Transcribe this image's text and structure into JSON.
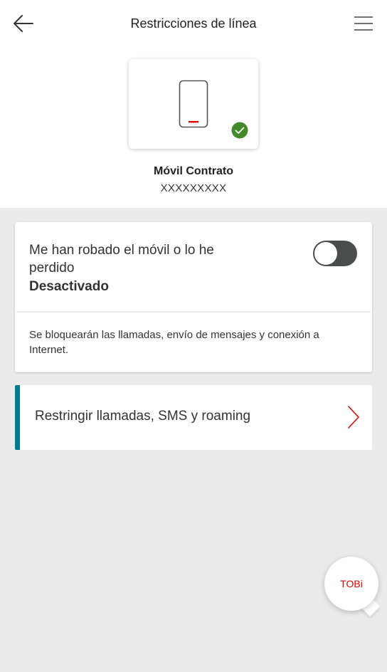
{
  "header": {
    "title": "Restricciones de línea",
    "back_icon": "arrow-left-icon",
    "menu_icon": "hamburger-menu-icon"
  },
  "device": {
    "name": "Móvil Contrato",
    "number": "XXXXXXXXX",
    "icon": "mobile-phone-icon",
    "status_icon": "check-circle-icon",
    "status_color": "#428a2a"
  },
  "lost_stolen": {
    "title": "Me han robado el móvil o lo he perdido",
    "status": "Desactivado",
    "toggle_on": false,
    "description": "Se bloquearán las llamadas, envío de mensajes y conexión a Internet."
  },
  "restrict_link": {
    "label": "Restringir llamadas, SMS y roaming",
    "accent_color": "#007c92",
    "chevron_icon": "chevron-right-icon"
  },
  "assistant": {
    "label": "TOBi",
    "color": "#e60000"
  }
}
